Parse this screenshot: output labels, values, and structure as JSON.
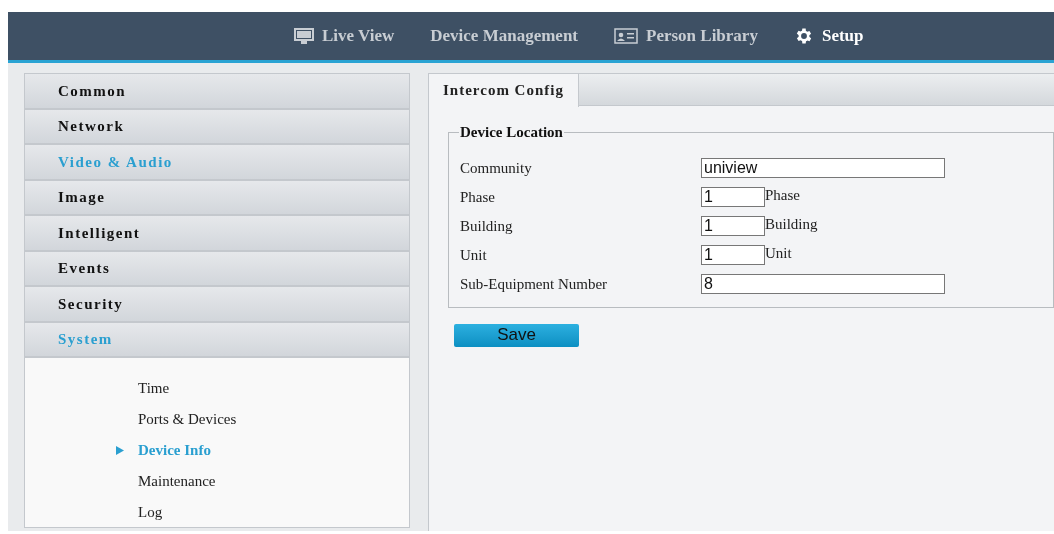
{
  "nav": {
    "tabs": [
      {
        "label": "Live View",
        "selected": false
      },
      {
        "label": "Device Management",
        "selected": false
      },
      {
        "label": "Person Library",
        "selected": false
      },
      {
        "label": "Setup",
        "selected": true
      }
    ]
  },
  "sidebar": {
    "items": [
      {
        "label": "Common",
        "highlighted": false
      },
      {
        "label": "Network",
        "highlighted": false
      },
      {
        "label": "Video & Audio",
        "highlighted": true
      },
      {
        "label": "Image",
        "highlighted": false
      },
      {
        "label": "Intelligent",
        "highlighted": false
      },
      {
        "label": "Events",
        "highlighted": false
      },
      {
        "label": "Security",
        "highlighted": false
      },
      {
        "label": "System",
        "highlighted": true,
        "children": [
          {
            "label": "Time",
            "selected": false
          },
          {
            "label": "Ports & Devices",
            "selected": false
          },
          {
            "label": "Device Info",
            "selected": true
          },
          {
            "label": "Maintenance",
            "selected": false
          },
          {
            "label": "Log",
            "selected": false
          }
        ]
      }
    ]
  },
  "content": {
    "tabs": [
      {
        "label": "Intercom Config",
        "selected": true
      }
    ],
    "fieldset": {
      "legend": "Device Location",
      "fields": [
        {
          "kind": "wide",
          "label": "Community",
          "value": "uniview"
        },
        {
          "kind": "narrow",
          "label": "Phase",
          "value": "1",
          "unit": "Phase"
        },
        {
          "kind": "narrow",
          "label": "Building",
          "value": "1",
          "unit": "Building"
        },
        {
          "kind": "narrow",
          "label": "Unit",
          "value": "1",
          "unit": "Unit"
        },
        {
          "kind": "wide",
          "label": "Sub-Equipment Number",
          "value": "8"
        }
      ]
    },
    "save_button": "Save"
  }
}
